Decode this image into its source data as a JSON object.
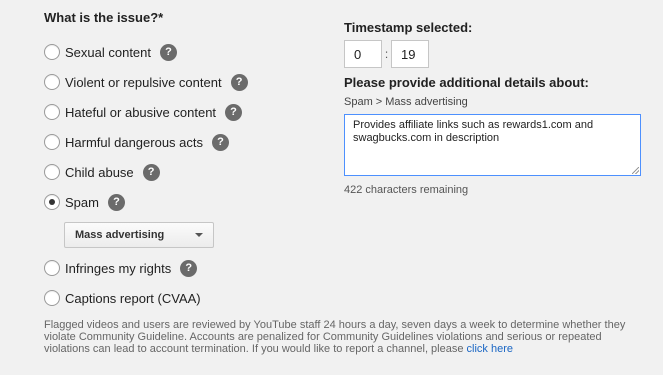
{
  "issue": {
    "title": "What is the issue?*",
    "help_glyph": "?",
    "options": [
      {
        "label": "Sexual content",
        "selected": false
      },
      {
        "label": "Violent or repulsive content",
        "selected": false
      },
      {
        "label": "Hateful or abusive content",
        "selected": false
      },
      {
        "label": "Harmful dangerous acts",
        "selected": false
      },
      {
        "label": "Child abuse",
        "selected": false
      },
      {
        "label": "Spam",
        "selected": true
      },
      {
        "label": "Infringes my rights",
        "selected": false
      },
      {
        "label": "Captions report (CVAA)",
        "selected": false
      }
    ],
    "spam_dropdown": {
      "selected": "Mass advertising"
    }
  },
  "timestamp": {
    "title": "Timestamp selected:",
    "minutes": "0",
    "separator": ":",
    "seconds": "19"
  },
  "details": {
    "title": "Please provide additional details about:",
    "breadcrumb": "Spam > Mass advertising",
    "text": "Provides affiliate links such as rewards1.com and swagbucks.com in description",
    "remaining": "422 characters remaining"
  },
  "footer": {
    "text": "Flagged videos and users are reviewed by YouTube staff 24 hours a day, seven days a week to determine whether they violate Community Guideline. Accounts are penalized for Community Guidelines violations and serious or repeated violations can lead to account termination. If you would like to report a channel, please",
    "link": "click here"
  },
  "colors": {
    "link": "#1a66c4",
    "focus_border": "#4d90fe",
    "help_bg": "#6b6b6b"
  }
}
